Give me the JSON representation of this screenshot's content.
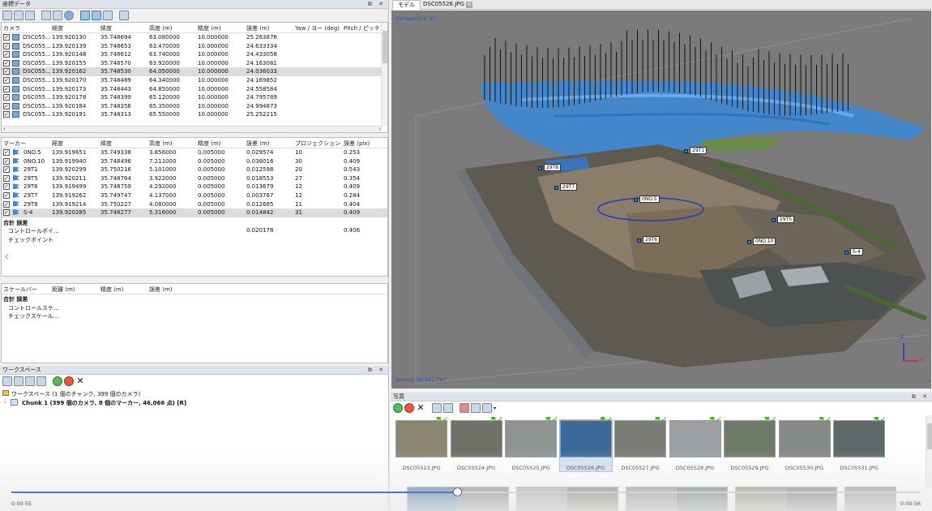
{
  "ref_panel": {
    "title": "座標データ",
    "camera_headers": [
      "カメラ",
      "経度",
      "緯度",
      "高度 (m)",
      "精度 (m)",
      "誤差 (m)",
      "Yaw / ヨー (deg)",
      "Pitch / ピッチ (c"
    ],
    "cameras": [
      {
        "name": "DSC055...",
        "lon": "139.920130",
        "lat": "35.748694",
        "alt": "63.080000",
        "acc": "10.000000",
        "err": "25.263876",
        "selected": false
      },
      {
        "name": "DSC055...",
        "lon": "139.920139",
        "lat": "35.748653",
        "alt": "63.470000",
        "acc": "10.000000",
        "err": "24.633334",
        "selected": false
      },
      {
        "name": "DSC055...",
        "lon": "139.920148",
        "lat": "35.748612",
        "alt": "63.740000",
        "acc": "10.000000",
        "err": "24.433058",
        "selected": false
      },
      {
        "name": "DSC055...",
        "lon": "139.920155",
        "lat": "35.748570",
        "alt": "63.920000",
        "acc": "10.000000",
        "err": "24.163081",
        "selected": false
      },
      {
        "name": "DSC055...",
        "lon": "139.920162",
        "lat": "35.748530",
        "alt": "64.050000",
        "acc": "10.000000",
        "err": "24.036033",
        "selected": true
      },
      {
        "name": "DSC055...",
        "lon": "139.920170",
        "lat": "35.748489",
        "alt": "64.340000",
        "acc": "10.000000",
        "err": "24.169852",
        "selected": false
      },
      {
        "name": "DSC055...",
        "lon": "139.920173",
        "lat": "35.748443",
        "alt": "64.850000",
        "acc": "10.000000",
        "err": "24.558584",
        "selected": false
      },
      {
        "name": "DSC055...",
        "lon": "139.920178",
        "lat": "35.748399",
        "alt": "65.120000",
        "acc": "10.000000",
        "err": "24.795789",
        "selected": false
      },
      {
        "name": "DSC055...",
        "lon": "139.920184",
        "lat": "35.748356",
        "alt": "65.350000",
        "acc": "10.000000",
        "err": "24.994873",
        "selected": false
      },
      {
        "name": "DSC055...",
        "lon": "139.920191",
        "lat": "35.748313",
        "alt": "65.550000",
        "acc": "10.000000",
        "err": "25.252215",
        "selected": false
      }
    ],
    "marker_headers": [
      "マーカー",
      "経度",
      "緯度",
      "高度 (m)",
      "精度 (m)",
      "誤差 (m)",
      "プロジェクション",
      "誤差 (pix)"
    ],
    "markers": [
      {
        "name": "0NO.5",
        "lon": "139.919651",
        "lat": "35.749338",
        "alt": "3.856000",
        "acc": "0.005000",
        "err": "0.029574",
        "proj": "10",
        "pix": "0.253",
        "selected": false
      },
      {
        "name": "0NO.10",
        "lon": "139.919940",
        "lat": "35.748496",
        "alt": "7.211000",
        "acc": "0.005000",
        "err": "0.036016",
        "proj": "30",
        "pix": "0.409",
        "selected": false
      },
      {
        "name": "29T1",
        "lon": "139.920299",
        "lat": "35.750216",
        "alt": "5.101000",
        "acc": "0.005000",
        "err": "0.012598",
        "proj": "20",
        "pix": "0.543",
        "selected": false
      },
      {
        "name": "29T5",
        "lon": "139.920211",
        "lat": "35.748764",
        "alt": "3.922000",
        "acc": "0.005000",
        "err": "0.018553",
        "proj": "27",
        "pix": "0.354",
        "selected": false
      },
      {
        "name": "29T6",
        "lon": "139.919499",
        "lat": "35.748759",
        "alt": "4.292000",
        "acc": "0.005000",
        "err": "0.013679",
        "proj": "12",
        "pix": "0.409",
        "selected": false
      },
      {
        "name": "29T7",
        "lon": "139.919262",
        "lat": "35.749747",
        "alt": "4.137000",
        "acc": "0.005000",
        "err": "0.003767",
        "proj": "12",
        "pix": "0.284",
        "selected": false
      },
      {
        "name": "29T8",
        "lon": "139.919214",
        "lat": "35.750227",
        "alt": "4.080000",
        "acc": "0.005000",
        "err": "0.012685",
        "proj": "11",
        "pix": "0.404",
        "selected": false
      },
      {
        "name": "S-4",
        "lon": "139.920285",
        "lat": "35.748277",
        "alt": "5.316000",
        "acc": "0.005000",
        "err": "0.014842",
        "proj": "31",
        "pix": "0.409",
        "selected": true
      }
    ],
    "marker_total": {
      "title": "合計 誤差",
      "control_label": "コントロールポイ...",
      "control_err": "0.020178",
      "control_pix": "0.406",
      "check_label": "チェックポイント"
    },
    "scalebar_headers": [
      "スケールバー",
      "距離 (m)",
      "精度 (m)",
      "誤差 (m)"
    ],
    "scalebar_total": {
      "title": "合計 誤差",
      "control_label": "コントロールスケ...",
      "check_label": "チェックスケール..."
    }
  },
  "workspace": {
    "title": "ワークスペース",
    "root_label": "ワークスペース (1 個のチャンク, 399 個のカメラ)",
    "chunk_label": "Chunk 1 (399 個のカメラ, 8 個のマーカー, 46,066 点) [R]"
  },
  "model_view": {
    "tabs": [
      "モデル",
      "DSC05526.JPG"
    ],
    "perspective": "Perspective 30°",
    "points": "points: 56,401,787",
    "markers": [
      "29T1",
      "29T8",
      "29T7",
      "0NO.5",
      "29T5",
      "29T6",
      "0NO.10",
      "S-4"
    ],
    "axes": [
      "Z",
      "Y",
      "X"
    ],
    "colors": {
      "background": "#7b7b7b",
      "flight_path": "#3a8ad8",
      "marker": "#2f7ad6"
    }
  },
  "photos": {
    "title": "写真",
    "row1": [
      "DSC05523.JPG",
      "DSC05524.JPG",
      "DSC05525.JPG",
      "DSC05526.JPG",
      "DSC05527.JPG",
      "DSC05528.JPG",
      "DSC05529.JPG",
      "DSC05530.JPG",
      "DSC05531.JPG"
    ],
    "selected": "DSC05526.JPG"
  },
  "video": {
    "current": "0:00:55",
    "total": "0:00:56",
    "progress": 0.49
  }
}
